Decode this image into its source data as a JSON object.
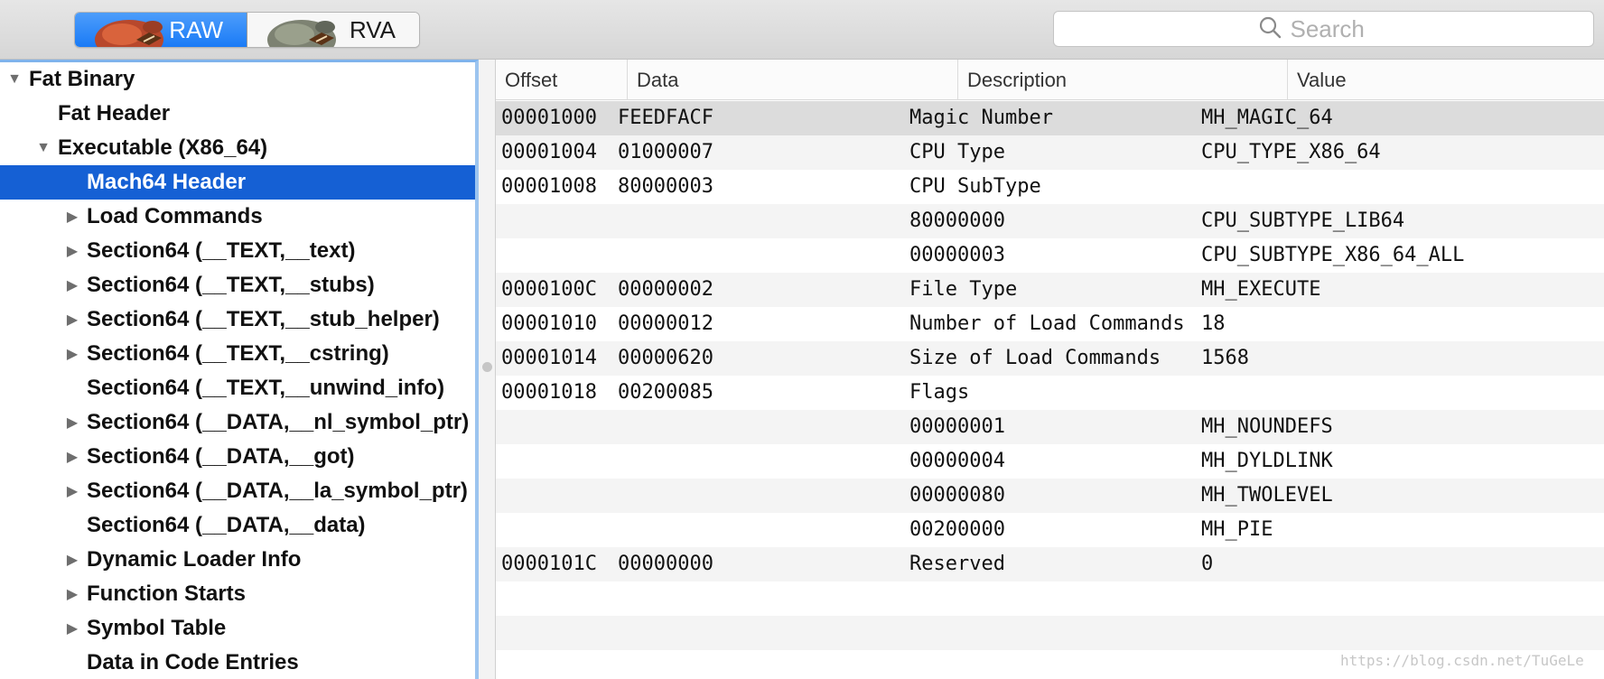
{
  "toolbar": {
    "segments": [
      {
        "label": "RAW",
        "selected": true
      },
      {
        "label": "RVA",
        "selected": false
      }
    ],
    "search": {
      "placeholder": "Search",
      "value": ""
    }
  },
  "tree": {
    "items": [
      {
        "label": "Fat Binary",
        "level": 0,
        "disclosure": "open"
      },
      {
        "label": "Fat Header",
        "level": 1,
        "disclosure": "none"
      },
      {
        "label": "Executable (X86_64)",
        "level": 1,
        "disclosure": "open"
      },
      {
        "label": "Mach64 Header",
        "level": 2,
        "disclosure": "none",
        "selected": true
      },
      {
        "label": "Load Commands",
        "level": 2,
        "disclosure": "closed"
      },
      {
        "label": "Section64 (__TEXT,__text)",
        "level": 2,
        "disclosure": "closed"
      },
      {
        "label": "Section64 (__TEXT,__stubs)",
        "level": 2,
        "disclosure": "closed"
      },
      {
        "label": "Section64 (__TEXT,__stub_helper)",
        "level": 2,
        "disclosure": "closed"
      },
      {
        "label": "Section64 (__TEXT,__cstring)",
        "level": 2,
        "disclosure": "closed"
      },
      {
        "label": "Section64 (__TEXT,__unwind_info)",
        "level": 2,
        "disclosure": "none"
      },
      {
        "label": "Section64 (__DATA,__nl_symbol_ptr)",
        "level": 2,
        "disclosure": "closed"
      },
      {
        "label": "Section64 (__DATA,__got)",
        "level": 2,
        "disclosure": "closed"
      },
      {
        "label": "Section64 (__DATA,__la_symbol_ptr)",
        "level": 2,
        "disclosure": "closed"
      },
      {
        "label": "Section64 (__DATA,__data)",
        "level": 2,
        "disclosure": "none"
      },
      {
        "label": "Dynamic Loader Info",
        "level": 2,
        "disclosure": "closed"
      },
      {
        "label": "Function Starts",
        "level": 2,
        "disclosure": "closed"
      },
      {
        "label": "Symbol Table",
        "level": 2,
        "disclosure": "closed"
      },
      {
        "label": "Data in Code Entries",
        "level": 2,
        "disclosure": "none"
      }
    ]
  },
  "table": {
    "columns": [
      "Offset",
      "Data",
      "Description",
      "Value"
    ],
    "rows": [
      {
        "offset": "00001000",
        "data": "FEEDFACF",
        "description": "Magic Number",
        "value": "MH_MAGIC_64",
        "selected": true
      },
      {
        "offset": "00001004",
        "data": "01000007",
        "description": "CPU Type",
        "value": "CPU_TYPE_X86_64"
      },
      {
        "offset": "00001008",
        "data": "80000003",
        "description": "CPU SubType",
        "value": ""
      },
      {
        "offset": "",
        "data": "",
        "description": "80000000",
        "value": "CPU_SUBTYPE_LIB64"
      },
      {
        "offset": "",
        "data": "",
        "description": "00000003",
        "value": "CPU_SUBTYPE_X86_64_ALL"
      },
      {
        "offset": "0000100C",
        "data": "00000002",
        "description": "File Type",
        "value": "MH_EXECUTE"
      },
      {
        "offset": "00001010",
        "data": "00000012",
        "description": "Number of Load Commands",
        "value": "18"
      },
      {
        "offset": "00001014",
        "data": "00000620",
        "description": "Size of Load Commands",
        "value": "1568"
      },
      {
        "offset": "00001018",
        "data": "00200085",
        "description": "Flags",
        "value": ""
      },
      {
        "offset": "",
        "data": "",
        "description": "00000001",
        "value": "MH_NOUNDEFS"
      },
      {
        "offset": "",
        "data": "",
        "description": "00000004",
        "value": "MH_DYLDLINK"
      },
      {
        "offset": "",
        "data": "",
        "description": "00000080",
        "value": "MH_TWOLEVEL"
      },
      {
        "offset": "",
        "data": "",
        "description": "00200000",
        "value": "MH_PIE"
      },
      {
        "offset": "0000101C",
        "data": "00000000",
        "description": "Reserved",
        "value": "0"
      },
      {
        "offset": "",
        "data": "",
        "description": "",
        "value": ""
      },
      {
        "offset": "",
        "data": "",
        "description": "",
        "value": ""
      }
    ]
  },
  "watermark": "https://blog.csdn.net/TuGeLe",
  "colors": {
    "accent": "#1560d4",
    "segment_selected": "#1a7bf6",
    "row_selected": "#dcdcdc",
    "row_alt": "#f4f4f4"
  }
}
